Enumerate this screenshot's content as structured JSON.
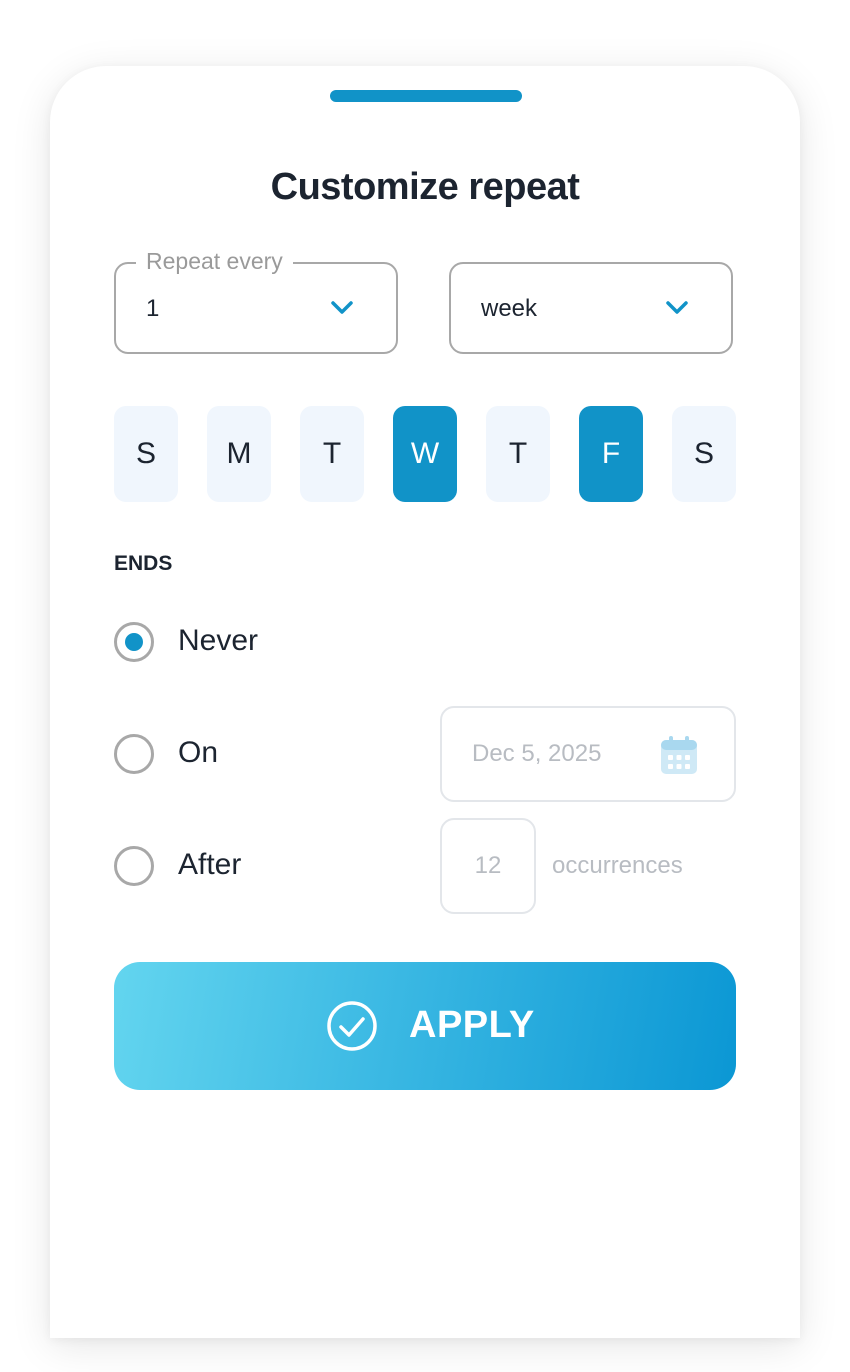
{
  "colors": {
    "accent": "#1193c8",
    "day_inactive_bg": "#f0f6fd",
    "text": "#1c2430",
    "placeholder": "#b8bcc2"
  },
  "title": "Customize repeat",
  "repeat": {
    "legend": "Repeat every",
    "interval_value": "1",
    "unit_value": "week",
    "chevron_icon": "chevron-down-icon"
  },
  "days": [
    {
      "label": "S",
      "selected": false
    },
    {
      "label": "M",
      "selected": false
    },
    {
      "label": "T",
      "selected": false
    },
    {
      "label": "W",
      "selected": true
    },
    {
      "label": "T",
      "selected": false
    },
    {
      "label": "F",
      "selected": true
    },
    {
      "label": "S",
      "selected": false
    }
  ],
  "ends": {
    "label": "ENDS",
    "options": [
      {
        "label": "Never",
        "selected": true
      },
      {
        "label": "On",
        "selected": false
      },
      {
        "label": "After",
        "selected": false
      }
    ],
    "date_placeholder": "Dec 5, 2025",
    "calendar_icon": "calendar-icon",
    "occurrences_placeholder": "12",
    "occurrences_label": "occurrences"
  },
  "apply": {
    "label": "APPLY",
    "icon": "check-circle-icon"
  }
}
